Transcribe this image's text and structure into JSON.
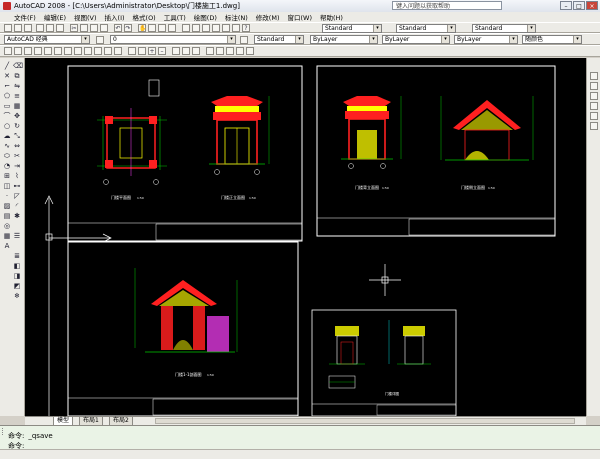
{
  "window": {
    "title": "AutoCAD 2008 - [C:\\Users\\Administrator\\Desktop\\门楼施工1.dwg]",
    "search_placeholder": "键入问题以获取帮助"
  },
  "menu": [
    "文件(F)",
    "编辑(E)",
    "视图(V)",
    "插入(I)",
    "格式(O)",
    "工具(T)",
    "绘图(D)",
    "标注(N)",
    "修改(M)",
    "窗口(W)",
    "帮助(H)"
  ],
  "toolbar": {
    "text_style": "Standard",
    "dim_style": "Standard",
    "table_style": "Standard",
    "workspace": "AutoCAD 经典",
    "layer": "0",
    "style_combo": "Standard",
    "color": "ByLayer",
    "linetype": "ByLayer",
    "lineweight": "ByLayer",
    "plotstyle": "随颜色"
  },
  "tabs": [
    "模型",
    "布局1",
    "布局2"
  ],
  "command": {
    "prompt1": "命令:",
    "value1": "_qsave",
    "prompt2": "命令:"
  },
  "drawings": {
    "sheet1_label_a": "门楼平面图",
    "sheet1_label_b": "门楼正立面图",
    "sheet1_scale_a": "1:50",
    "sheet1_scale_b": "1:50",
    "sheet2_label_a": "门楼背立面图",
    "sheet2_label_b": "门楼侧立面图",
    "sheet2_scale_a": "1:50",
    "sheet2_scale_b": "1:50",
    "sheet3_label": "门楼1-1剖面图",
    "sheet3_scale": "1:50",
    "sheet4_label": "门楼详图"
  },
  "colors": {
    "canvas_bg": "#000000",
    "frame": "#ffffff",
    "roof_red": "#ff2020",
    "yellow": "#ffff00",
    "green": "#00c800",
    "magenta": "#ff40ff",
    "cyan": "#00ffff"
  }
}
